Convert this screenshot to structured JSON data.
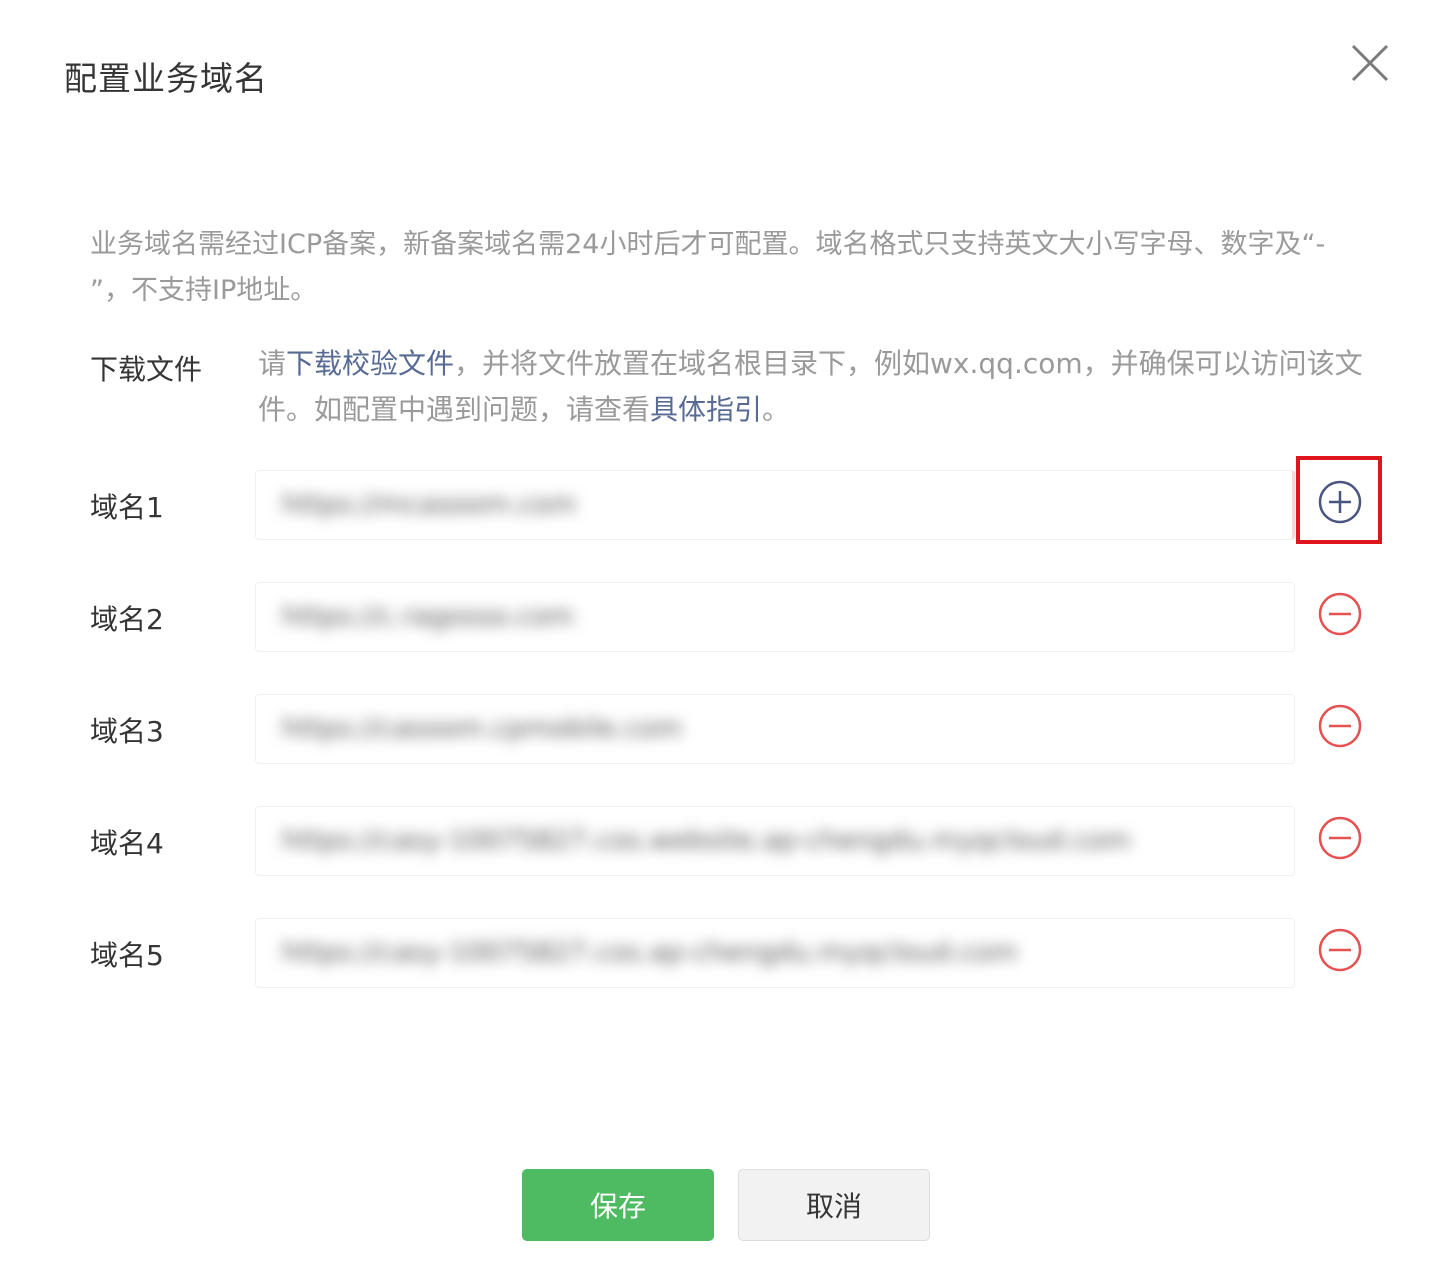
{
  "dialog": {
    "title": "配置业务域名",
    "close_icon": "close-icon"
  },
  "notice": {
    "text": "业务域名需经过ICP备案，新备案域名需24小时后才可配置。域名格式只支持英文大小写字母、数字及“- ”，不支持IP地址。"
  },
  "download": {
    "label": "下载文件",
    "prefix": "请",
    "link_text": "下载校验文件",
    "middle": "，并将文件放置在域名根目录下，例如wx.qq.com，并确保可以访问该文件。如配置中遇到问题，请查看",
    "guide_link": "具体指引",
    "suffix": "。"
  },
  "domains": [
    {
      "label": "域名1",
      "value": "https://mcasoom.com",
      "action_icon": "plus-circle-icon"
    },
    {
      "label": "域名2",
      "value": "https://c.ragosso.com",
      "action_icon": "minus-circle-icon"
    },
    {
      "label": "域名3",
      "value": "https://casoom.cpmobile.com",
      "action_icon": "minus-circle-icon"
    },
    {
      "label": "域名4",
      "value": "https://casy-10075827.cos.website.ap-chengdu.myqcloud.com",
      "action_icon": "minus-circle-icon"
    },
    {
      "label": "域名5",
      "value": "https://casy-10075827.cos.ap-chengdu.myqcloud.com",
      "action_icon": "minus-circle-icon"
    }
  ],
  "colors": {
    "link": "#576b95",
    "add_icon": "#4a5680",
    "remove_icon": "#e5524f",
    "save_button": "#4eba61",
    "highlight": "#e0141e"
  },
  "footer": {
    "save_label": "保存",
    "cancel_label": "取消"
  }
}
